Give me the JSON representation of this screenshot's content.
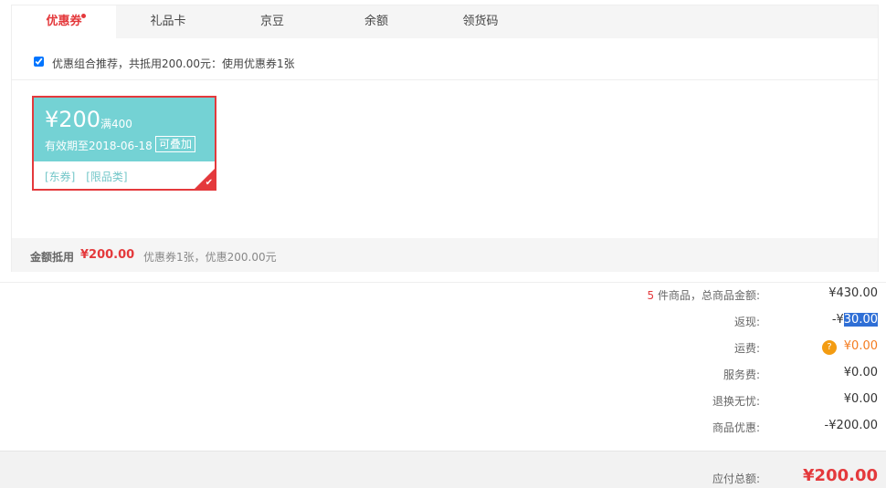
{
  "tabs": [
    {
      "label": "优惠券",
      "active": true
    },
    {
      "label": "礼品卡"
    },
    {
      "label": "京豆"
    },
    {
      "label": "余额"
    },
    {
      "label": "领货码"
    }
  ],
  "combo": {
    "checked": true,
    "text": "优惠组合推荐，共抵用200.00元：使用优惠券1张"
  },
  "coupon": {
    "amount": "¥200",
    "condition": "满400",
    "validity": "有效期至2018-06-18",
    "stackable": "可叠加",
    "tags": [
      "[东券]",
      "[限品类]"
    ],
    "selected": true
  },
  "summary": {
    "label": "金额抵用",
    "amount": "¥200.00",
    "detail": "优惠券1张，优惠200.00元"
  },
  "prices": {
    "item_count": "5",
    "goods_label": " 件商品，总商品金额:",
    "goods_value": "¥430.00",
    "cashback_label": "返现:",
    "cashback_prefix": "-¥",
    "cashback_selected": "30.00",
    "shipping_label": "运费:",
    "shipping_help": "?",
    "shipping_value": "¥0.00",
    "service_label": "服务费:",
    "service_value": "¥0.00",
    "return_label": "退换无忧:",
    "return_value": "¥0.00",
    "discount_label": "商品优惠:",
    "discount_value": "-¥200.00"
  },
  "total": {
    "label": "应付总额:",
    "value": "¥200.00"
  },
  "colors": {
    "accent": "#e4393c",
    "coupon": "#74d2d4",
    "shipping": "#f47c20",
    "help": "#f39c12"
  },
  "icons": {
    "help": "question-circle-icon",
    "check": "checkmark-icon"
  }
}
